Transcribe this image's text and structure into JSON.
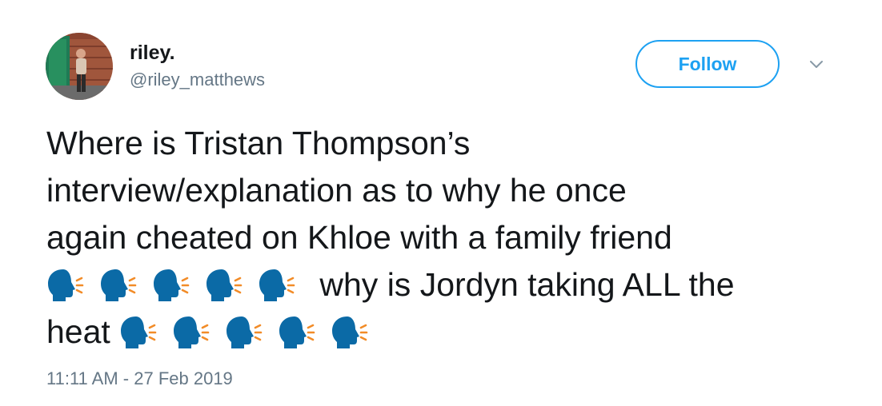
{
  "user": {
    "display_name": "riley.",
    "handle": "@riley_matthews",
    "avatar_icon": "profile-photo"
  },
  "header": {
    "follow_label": "Follow",
    "menu_icon": "chevron-down-icon"
  },
  "tweet": {
    "line1": "Where is Tristan Thompson’s",
    "line2": "interview/explanation as to why he once",
    "line3": "again cheated on Khloe with a family friend",
    "line4_text": " why is Jordyn taking ALL the",
    "line5_text": "heat",
    "emoji_icon": "speaking-head-emoji",
    "emoji_group_1_count": 5,
    "emoji_group_2_count": 5,
    "timestamp": "11:11 AM - 27 Feb 2019"
  },
  "colors": {
    "accent": "#1da1f2",
    "text": "#14171a",
    "muted": "#657786",
    "emoji_head": "#0b6aa6",
    "emoji_sound": "#f28c28"
  }
}
